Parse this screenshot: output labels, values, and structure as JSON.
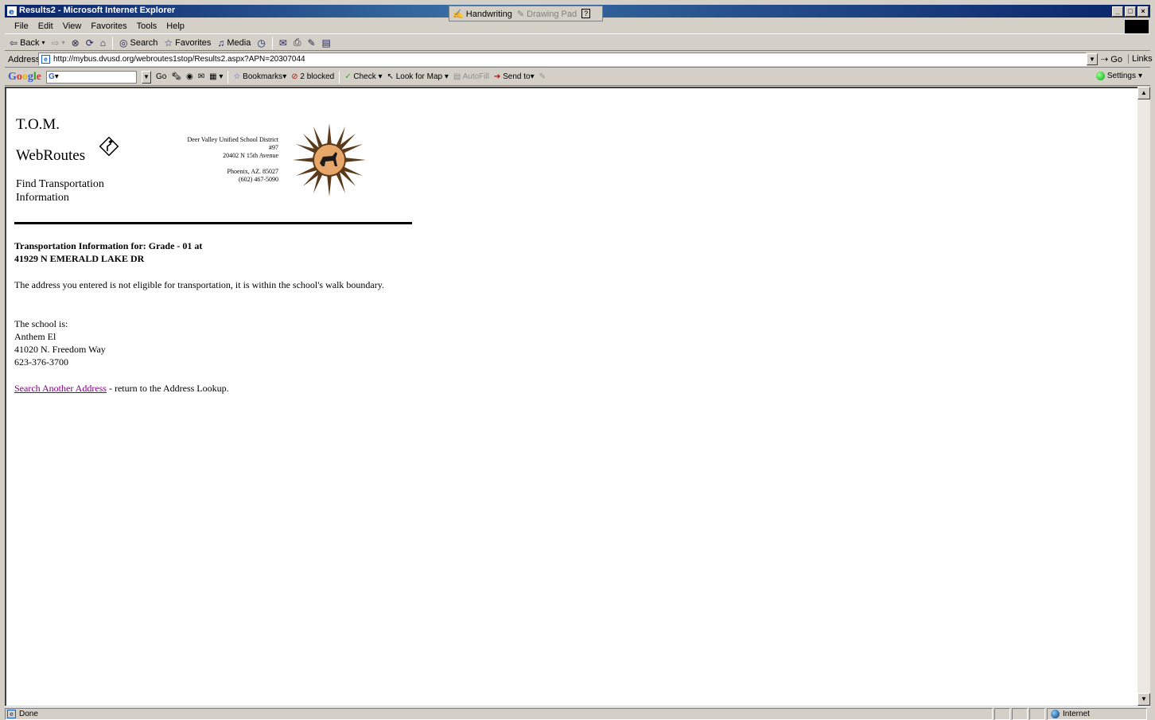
{
  "window": {
    "title": "Results2 - Microsoft Internet Explorer",
    "pen_bar": {
      "handwriting": "Handwriting",
      "drawing_pad": "Drawing Pad",
      "help": "?"
    },
    "buttons": {
      "minimize": "_",
      "maximize": "□",
      "close": "×"
    }
  },
  "menu": [
    "File",
    "Edit",
    "View",
    "Favorites",
    "Tools",
    "Help"
  ],
  "toolbar": {
    "back": "Back",
    "search": "Search",
    "favorites": "Favorites",
    "media": "Media"
  },
  "address": {
    "label": "Address",
    "url": "http://mybus.dvusd.org/webroutes1stop/Results2.aspx?APN=20307044",
    "go": "Go",
    "links": "Links"
  },
  "google_bar": {
    "logo": "Google",
    "go": "Go",
    "bookmarks": "Bookmarks",
    "blocked": "2 blocked",
    "check": "Check",
    "look_for_map": "Look for Map",
    "autofill": "AutoFill",
    "send_to": "Send to",
    "settings": "Settings"
  },
  "page": {
    "brand_line1": "T.O.M.",
    "brand_line2": "WebRoutes",
    "brand_line3": "Find Transportation Information",
    "district": {
      "name": "Deer Valley Unified School District",
      "number": "#97",
      "street": "20402 N 15th Avenue",
      "city": "Phoenix, AZ. 85027",
      "phone": "(602) 467-5090"
    },
    "heading_line1": "Transportation Information for: Grade - 01 at",
    "heading_line2": "41929 N EMERALD LAKE DR",
    "message": "The address you entered is not eligible for transportation, it is within the school's walk boundary.",
    "school_label": "The school is:",
    "school_name": "Anthem El",
    "school_address": "41020 N. Freedom Way",
    "school_phone": "623-376-3700",
    "search_link": "Search Another Address",
    "search_suffix": " - return to the Address Lookup."
  },
  "status": {
    "text": "Done",
    "zone": "Internet"
  }
}
